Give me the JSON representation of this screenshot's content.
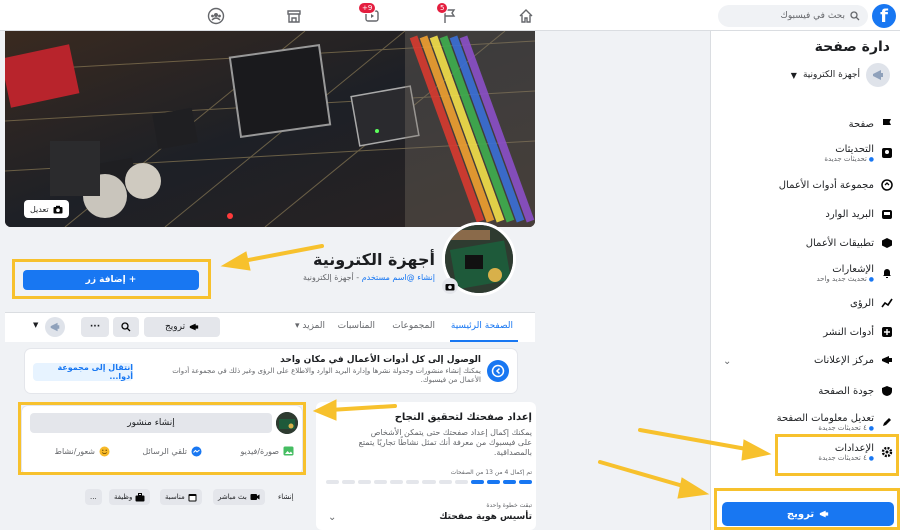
{
  "colors": {
    "accent": "#1877f2",
    "highlight": "#f7c12d"
  },
  "topbar": {
    "search_placeholder": "بحث في فيسبوك",
    "icons": [
      "facebook-logo",
      "search-icon",
      "home-icon",
      "flag-icon",
      "video-icon",
      "store-icon",
      "groups-icon"
    ],
    "flag_badge": "5",
    "video_badge": "+9"
  },
  "sidebar": {
    "title": "دارة صفحة",
    "page_name": "أجهزة الكترونية",
    "items": [
      {
        "label": "صفحة",
        "sub": ""
      },
      {
        "label": "التحديثات",
        "sub": "تحديثات جديدة"
      },
      {
        "label": "مجموعة أدوات الأعمال",
        "sub": ""
      },
      {
        "label": "البريد الوارد",
        "sub": ""
      },
      {
        "label": "تطبيقات الأعمال",
        "sub": ""
      },
      {
        "label": "الإشعارات",
        "sub": "تحديث جديد واحد"
      },
      {
        "label": "الرؤى",
        "sub": ""
      },
      {
        "label": "أدوات النشر",
        "sub": ""
      },
      {
        "label": "مركز الإعلانات",
        "sub": ""
      },
      {
        "label": "جودة الصفحة",
        "sub": ""
      },
      {
        "label": "تعديل معلومات الصفحة",
        "sub": "٤ تحديثات جديدة"
      },
      {
        "label": "الإعدادات",
        "sub": "٤ تحديثات جديدة"
      }
    ],
    "promote_label": "ترويج"
  },
  "header": {
    "edit_cover_label": "تعديل",
    "page_name": "أجهزة الكترونية",
    "sub_link": "إنشاء @اسم مستخدم",
    "sub_category": "- أجهزة إلكترونية",
    "add_button_label": "+ إضافة زر"
  },
  "tabs": {
    "items": [
      "الصفحة الرئيسية",
      "المجموعات",
      "المناسبات",
      "المزيد ▾"
    ],
    "promote_label": "ترويج"
  },
  "business_card": {
    "title": "الوصول إلى كل أدوات الأعمال في مكان واحد",
    "description": "يمكنك إنشاء منشورات وجدولة نشرها وإدارة البريد الوارد والاطلاع على الرؤى وغير ذلك في مجموعة أدوات الأعمال من فيسبوك.",
    "button_label": "انتقال إلى مجموعة أدوا..."
  },
  "post_card": {
    "input_label": "إنشاء منشور",
    "actions": [
      "صورة/فيديو",
      "تلقي الرسائل",
      "شعور/نشاط"
    ]
  },
  "tools": {
    "create_label": "إنشاء",
    "buttons": [
      "بث مباشر",
      "مناسبة",
      "وظيفة",
      "..."
    ]
  },
  "setup_card": {
    "title": "إعداد صفحتك لتحقيق النجاح",
    "description": "يمكنك إكمال إعداد صفحتك حتى يتمكن الأشخاص على فيسبوك من معرفة أنك تمثل نشاطًا تجاريًا يتمتع بالمصداقية.",
    "progress_text": "تم إكمال 4 من 13 من الصفحات",
    "progress": {
      "completed": 4,
      "total": 13
    },
    "next_step_label": "تبقت خطوة واحدة",
    "next_step_title": "تأسيس هوية صفحتك"
  }
}
